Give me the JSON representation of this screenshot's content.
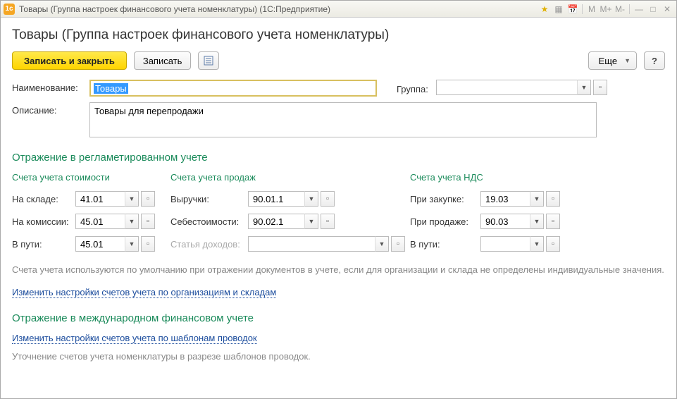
{
  "titlebar": {
    "app_icon": "1c",
    "title": "Товары (Группа настроек финансового учета номенклатуры)  (1С:Предприятие)"
  },
  "header": {
    "title": "Товары (Группа настроек финансового учета номенклатуры)"
  },
  "toolbar": {
    "save_close": "Записать и закрыть",
    "save": "Записать",
    "more": "Еще",
    "help": "?"
  },
  "fields": {
    "name_label": "Наименование:",
    "name_value": "Товары",
    "group_label": "Группа:",
    "group_value": "",
    "desc_label": "Описание:",
    "desc_value": "Товары для перепродажи"
  },
  "section_reg": {
    "title": "Отражение в регламетированном учете",
    "col_cost": "Счета учета стоимости",
    "col_sales": "Счета учета продаж",
    "col_vat": "Счета учета НДС",
    "warehouse_label": "На складе:",
    "warehouse_value": "41.01",
    "commission_label": "На комиссии:",
    "commission_value": "45.01",
    "transit_label": "В пути:",
    "transit_value": "45.01",
    "revenue_label": "Выручки:",
    "revenue_value": "90.01.1",
    "cost_label": "Себестоимости:",
    "cost_value": "90.02.1",
    "income_item_label": "Статья доходов:",
    "income_item_value": "",
    "vat_purchase_label": "При закупке:",
    "vat_purchase_value": "19.03",
    "vat_sale_label": "При продаже:",
    "vat_sale_value": "90.03",
    "vat_transit_label": "В пути:",
    "vat_transit_value": "",
    "note": "Счета учета используются по умолчанию при отражении документов в учете, если для организации и склада не определены индивидуальные значения.",
    "link": "Изменить настройки счетов учета по организациям и складам"
  },
  "section_intl": {
    "title": "Отражение в международном финансовом учете",
    "link": "Изменить настройки счетов учета по шаблонам проводок",
    "note": "Уточнение счетов учета номенклатуры в разрезе шаблонов проводок."
  }
}
